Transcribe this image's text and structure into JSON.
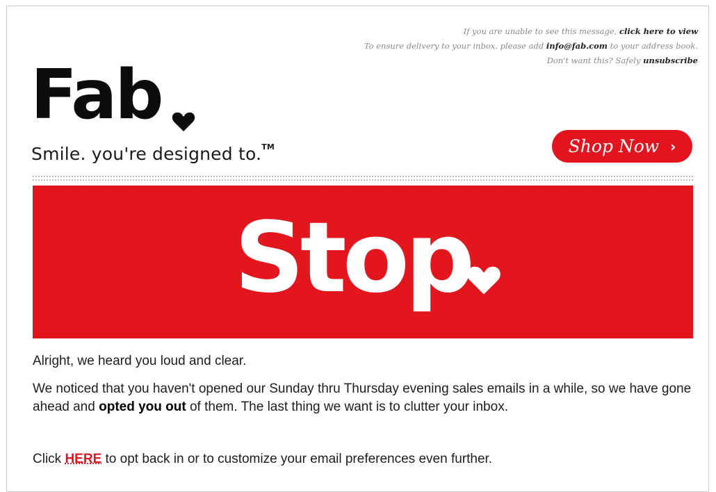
{
  "header": {
    "line1_prefix": "If you are unable to see this message,",
    "line1_link": "click here to view",
    "line2_prefix": "To ensure delivery to your inbox, please add",
    "line2_email": "info@fab.com",
    "line2_suffix": "to your address book.",
    "line3_prefix": "Don't want this? Safely",
    "line3_link": "unsubscribe"
  },
  "brand": {
    "logo_text": "Fab",
    "tagline": "Smile. you're designed to.",
    "tagline_mark": "TM",
    "accent_color": "#e3141d"
  },
  "cta": {
    "shop_label": "Shop Now",
    "chevron": "›"
  },
  "banner": {
    "word": "Stop"
  },
  "content": {
    "p1": "Alright, we heard you loud and clear.",
    "p2_a": "We noticed that you haven't opened our Sunday thru Thursday evening sales emails in a while, so we have gone ahead and",
    "p2_bold": "opted you out",
    "p2_b": "of them. The last thing we want is to clutter your inbox.",
    "p3_a": "Click",
    "p3_link": "HERE",
    "p3_b": "to opt back in or to customize your email preferences even further."
  }
}
